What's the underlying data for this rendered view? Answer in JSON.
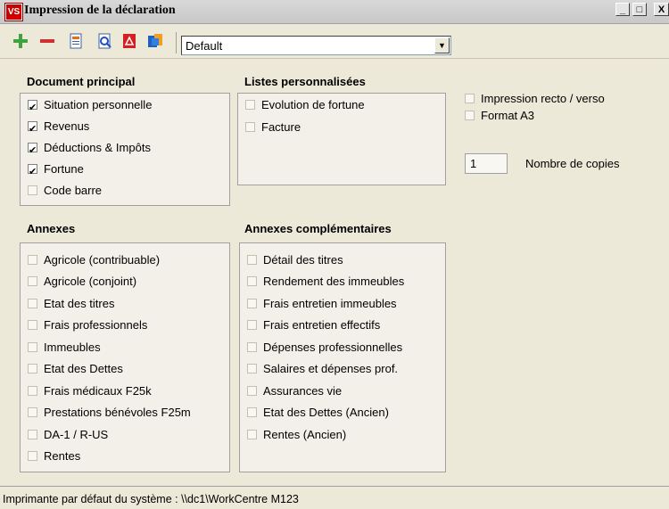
{
  "window": {
    "title": "Impression de la déclaration",
    "app_icon_text": "VS",
    "minimize": "_",
    "maximize": "□",
    "close": "X"
  },
  "toolbar": {
    "icons": [
      "plus-icon",
      "minus-icon",
      "document-icon",
      "preview-icon",
      "pdf-icon",
      "export-icon"
    ],
    "profile_value": "Default"
  },
  "document_principal": {
    "title": "Document principal",
    "items": [
      {
        "label": "Situation personnelle",
        "checked": true
      },
      {
        "label": "Revenus",
        "checked": true
      },
      {
        "label": "Déductions & Impôts",
        "checked": true
      },
      {
        "label": "Fortune",
        "checked": true
      },
      {
        "label": "Code barre",
        "checked": false
      }
    ]
  },
  "listes_personnalisees": {
    "title": "Listes personnalisées",
    "items": [
      {
        "label": "Evolution de fortune",
        "checked": false
      },
      {
        "label": "Facture",
        "checked": false
      }
    ]
  },
  "annexes": {
    "title": "Annexes",
    "items": [
      {
        "label": "Agricole (contribuable)",
        "checked": false
      },
      {
        "label": "Agricole (conjoint)",
        "checked": false
      },
      {
        "label": "Etat des titres",
        "checked": false
      },
      {
        "label": "Frais professionnels",
        "checked": false
      },
      {
        "label": "Immeubles",
        "checked": false
      },
      {
        "label": "Etat des Dettes",
        "checked": false
      },
      {
        "label": "Frais médicaux F25k",
        "checked": false
      },
      {
        "label": "Prestations bénévoles F25m",
        "checked": false
      },
      {
        "label": "DA-1 / R-US",
        "checked": false
      },
      {
        "label": "Rentes",
        "checked": false
      }
    ]
  },
  "annexes_complementaires": {
    "title": "Annexes complémentaires",
    "items": [
      {
        "label": "Détail des titres",
        "checked": false
      },
      {
        "label": "Rendement des immeubles",
        "checked": false
      },
      {
        "label": "Frais entretien immeubles",
        "checked": false
      },
      {
        "label": "Frais entretien effectifs",
        "checked": false
      },
      {
        "label": "Dépenses professionnelles",
        "checked": false
      },
      {
        "label": "Salaires et dépenses prof.",
        "checked": false
      },
      {
        "label": "Assurances vie",
        "checked": false
      },
      {
        "label": "Etat des Dettes (Ancien)",
        "checked": false
      },
      {
        "label": "Rentes (Ancien)",
        "checked": false
      }
    ]
  },
  "options": {
    "recto_verso": {
      "label": "Impression recto / verso",
      "checked": false
    },
    "format_a3": {
      "label": "Format A3",
      "checked": false
    },
    "copies_value": "1",
    "copies_label": "Nombre de copies"
  },
  "status": {
    "text": "Imprimante par défaut du système : \\\\dc1\\WorkCentre M123"
  }
}
